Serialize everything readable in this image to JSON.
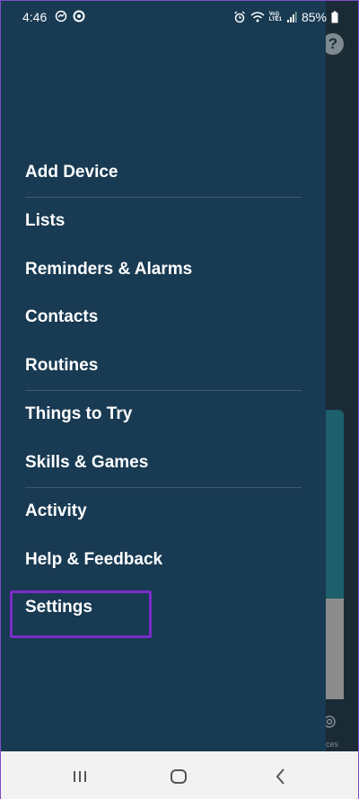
{
  "status_bar": {
    "time": "4:46",
    "battery": "85%",
    "left_icons": [
      "sync-icon",
      "settings-gear-icon"
    ],
    "right_icons": [
      "alarm-icon",
      "wifi-icon",
      "volte-icon",
      "signal-icon",
      "battery-icon"
    ],
    "volte_line1": "Vo))",
    "volte_line2": "LTE1"
  },
  "background_app": {
    "help_icon_glyph": "?",
    "devices_label": "ces"
  },
  "menu": {
    "groups": [
      [
        {
          "id": "add-device",
          "label": "Add Device"
        }
      ],
      [
        {
          "id": "lists",
          "label": "Lists"
        },
        {
          "id": "reminders-alarms",
          "label": "Reminders & Alarms"
        },
        {
          "id": "contacts",
          "label": "Contacts"
        },
        {
          "id": "routines",
          "label": "Routines"
        }
      ],
      [
        {
          "id": "things-to-try",
          "label": "Things to Try"
        },
        {
          "id": "skills-games",
          "label": "Skills & Games"
        }
      ],
      [
        {
          "id": "activity",
          "label": "Activity"
        },
        {
          "id": "help-feedback",
          "label": "Help & Feedback"
        },
        {
          "id": "settings",
          "label": "Settings"
        }
      ]
    ]
  },
  "highlight": {
    "target": "settings",
    "color": "#7b2cc9"
  },
  "nav_bar": {
    "buttons": [
      "recent-apps-icon",
      "home-icon",
      "back-icon"
    ]
  },
  "colors": {
    "drawer_bg": "#183a52",
    "divider": "#3c5a6e",
    "text": "#ffffff"
  }
}
